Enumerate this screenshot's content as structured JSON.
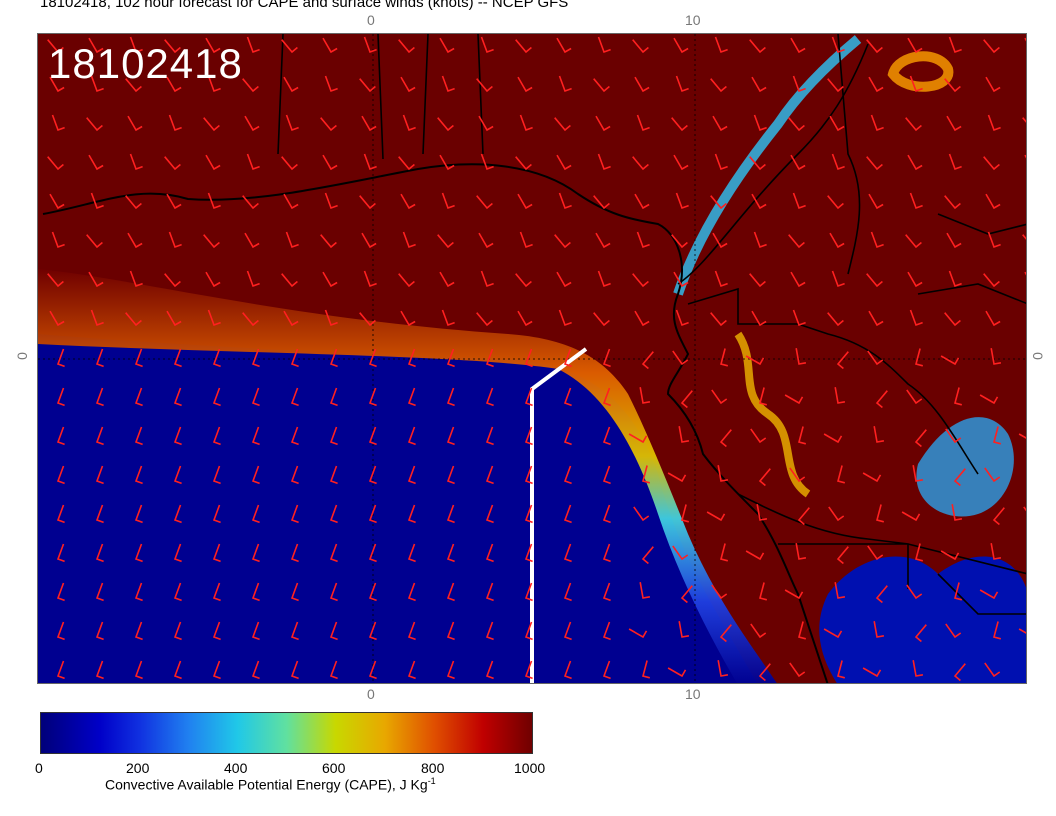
{
  "title": "18102418, 102 hour forecast for CAPE and surface winds (knots) -- NCEP GFS",
  "stamp": "18102418",
  "axis_ticks": {
    "top_0": "0",
    "top_10": "10",
    "bottom_0": "0",
    "bottom_10": "10",
    "left_0": "0",
    "right_0": "0"
  },
  "colorbar": {
    "labels": [
      "0",
      "200",
      "400",
      "600",
      "800",
      "1000"
    ],
    "caption": "Convective Available Potential Energy (CAPE), J Kg",
    "caption_sup": "-1",
    "colors": [
      "#00007a",
      "#0000c8",
      "#2080f0",
      "#20c8e8",
      "#c8d800",
      "#e8a800",
      "#e05000",
      "#c00000",
      "#700000"
    ]
  },
  "colors": {
    "high_cape": "#700000",
    "low_cape": "#000090",
    "wind_barb": "#ff2020",
    "coastline": "#000000",
    "track": "#ffffff"
  }
}
